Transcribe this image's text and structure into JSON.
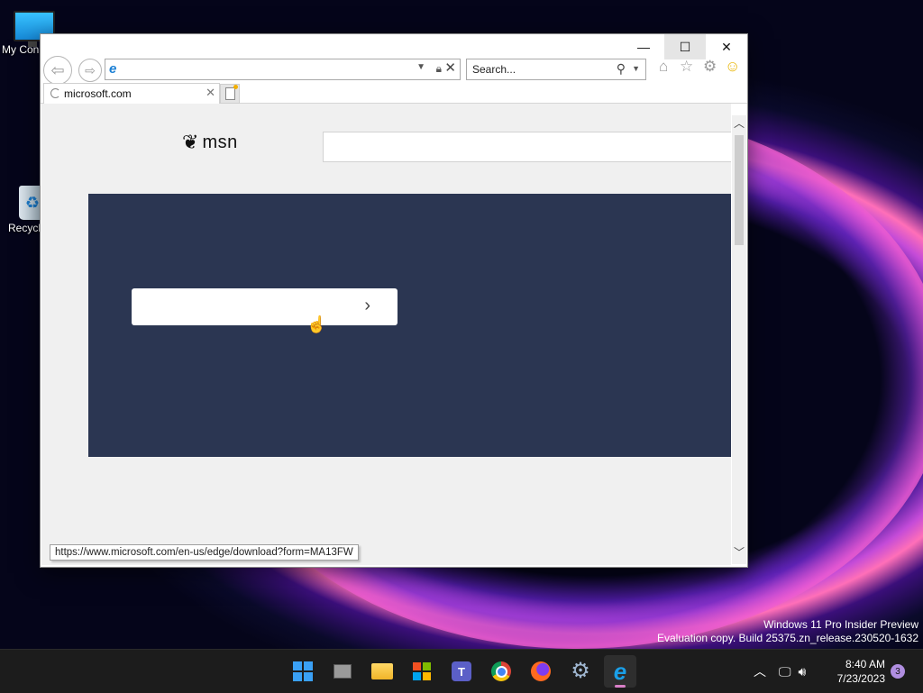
{
  "desktop": {
    "icons": [
      {
        "label": "My Con"
      },
      {
        "label": "Recycl"
      }
    ],
    "watermark": {
      "line1": "Windows 11 Pro Insider Preview",
      "line2": "Evaluation copy. Build 25375.zn_release.230520-1632"
    }
  },
  "browser": {
    "address_value": "",
    "search_placeholder": "Search...",
    "tab": {
      "title": "microsoft.com"
    },
    "status_url": "https://www.microsoft.com/en-us/edge/download?form=MA13FW",
    "window_controls": {
      "minimize": "—",
      "maximize": "☐",
      "close": "✕"
    }
  },
  "page": {
    "msn_logo_text": "msn",
    "search_value": "",
    "hero_button_label": ""
  },
  "taskbar": {
    "apps": [
      "start-icon",
      "task-view-icon",
      "file-explorer-icon",
      "store-icon",
      "teams-icon",
      "chrome-icon",
      "firefox-icon",
      "settings-icon",
      "internet-explorer-icon"
    ],
    "active_app": "internet-explorer-icon",
    "clock": {
      "time": "8:40 AM",
      "date": "7/23/2023"
    },
    "notification_count": "3"
  },
  "colors": {
    "hero_bg": "#2b3652",
    "page_bg": "#f0f0f0",
    "taskbar_bg": "#1c1c1c",
    "ie_blue": "#1a7fd4"
  }
}
